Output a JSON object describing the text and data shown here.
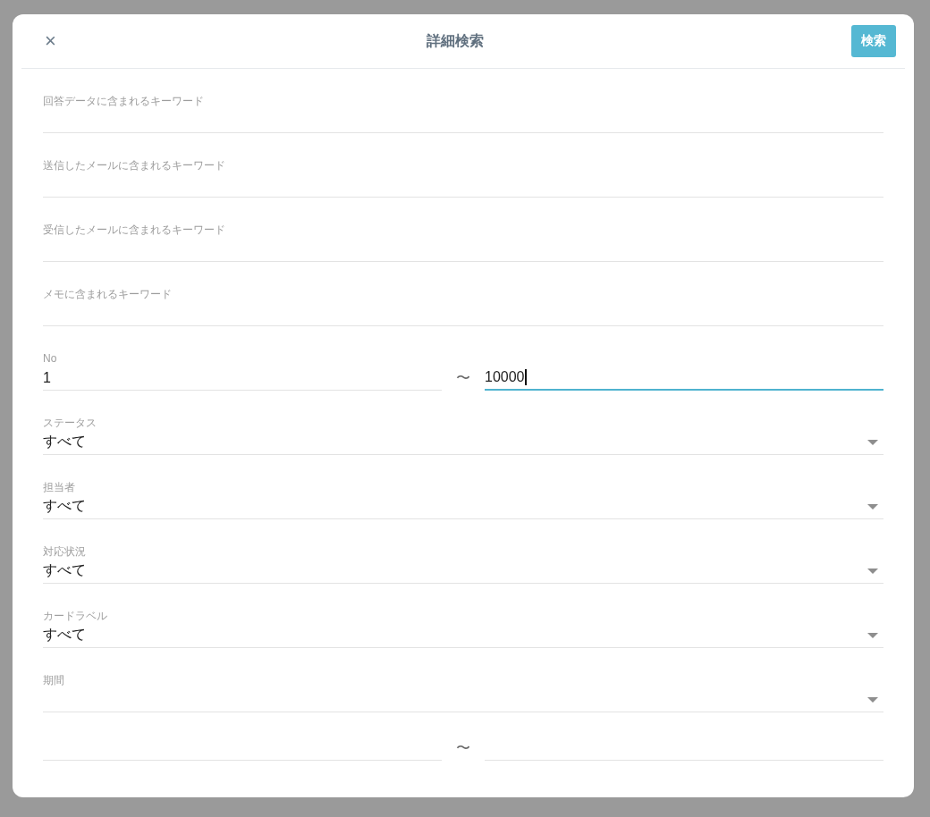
{
  "dialog": {
    "title": "詳細検索",
    "close_label": "×",
    "search_button": "検索"
  },
  "fields": [
    {
      "kind": "text",
      "label": "回答データに含まれるキーワード"
    },
    {
      "kind": "text",
      "label": "送信したメールに含まれるキーワード"
    },
    {
      "kind": "text",
      "label": "受信したメールに含まれるキーワード"
    },
    {
      "kind": "text",
      "label": "メモに含まれるキーワード"
    },
    {
      "kind": "range",
      "label": "No",
      "from": "1",
      "separator": "〜",
      "to": "10000",
      "to_focused": true
    },
    {
      "kind": "select",
      "label": "ステータス",
      "value": "すべて"
    },
    {
      "kind": "select",
      "label": "担当者",
      "value": "すべて"
    },
    {
      "kind": "select",
      "label": "対応状況",
      "value": "すべて"
    },
    {
      "kind": "select",
      "label": "カードラベル",
      "value": "すべて"
    },
    {
      "kind": "select",
      "label": "期間"
    },
    {
      "kind": "date_range",
      "separator": "〜"
    }
  ]
}
